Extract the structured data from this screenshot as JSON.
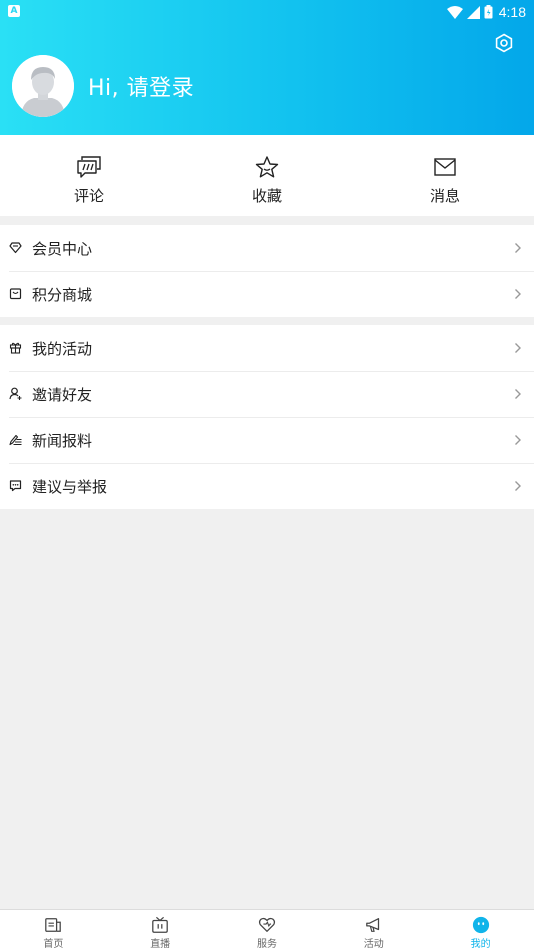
{
  "status_bar": {
    "time": "4:18",
    "app_icon_letter": "A"
  },
  "header": {
    "greeting": "Hi, 请登录",
    "settings_icon": "settings-icon",
    "avatar_icon": "avatar-placeholder"
  },
  "quick_actions": [
    {
      "label": "评论",
      "icon": "comment-icon"
    },
    {
      "label": "收藏",
      "icon": "star-icon"
    },
    {
      "label": "消息",
      "icon": "mail-icon"
    }
  ],
  "menu_group_1": [
    {
      "label": "会员中心",
      "icon": "diamond-icon"
    },
    {
      "label": "积分商城",
      "icon": "shopping-bag-icon"
    }
  ],
  "menu_group_2": [
    {
      "label": "我的活动",
      "icon": "gift-icon"
    },
    {
      "label": "邀请好友",
      "icon": "add-user-icon"
    },
    {
      "label": "新闻报料",
      "icon": "pen-icon"
    },
    {
      "label": "建议与举报",
      "icon": "feedback-icon"
    }
  ],
  "tabbar": [
    {
      "label": "首页",
      "icon": "news-icon",
      "active": false
    },
    {
      "label": "直播",
      "icon": "tv-icon",
      "active": false
    },
    {
      "label": "服务",
      "icon": "heart-icon",
      "active": false
    },
    {
      "label": "活动",
      "icon": "megaphone-icon",
      "active": false
    },
    {
      "label": "我的",
      "icon": "profile-face-icon",
      "active": true
    }
  ],
  "colors": {
    "accent": "#10b4ea",
    "header_start": "#2ae0f5",
    "header_end": "#03a7ea",
    "background": "#f0f0f0"
  }
}
